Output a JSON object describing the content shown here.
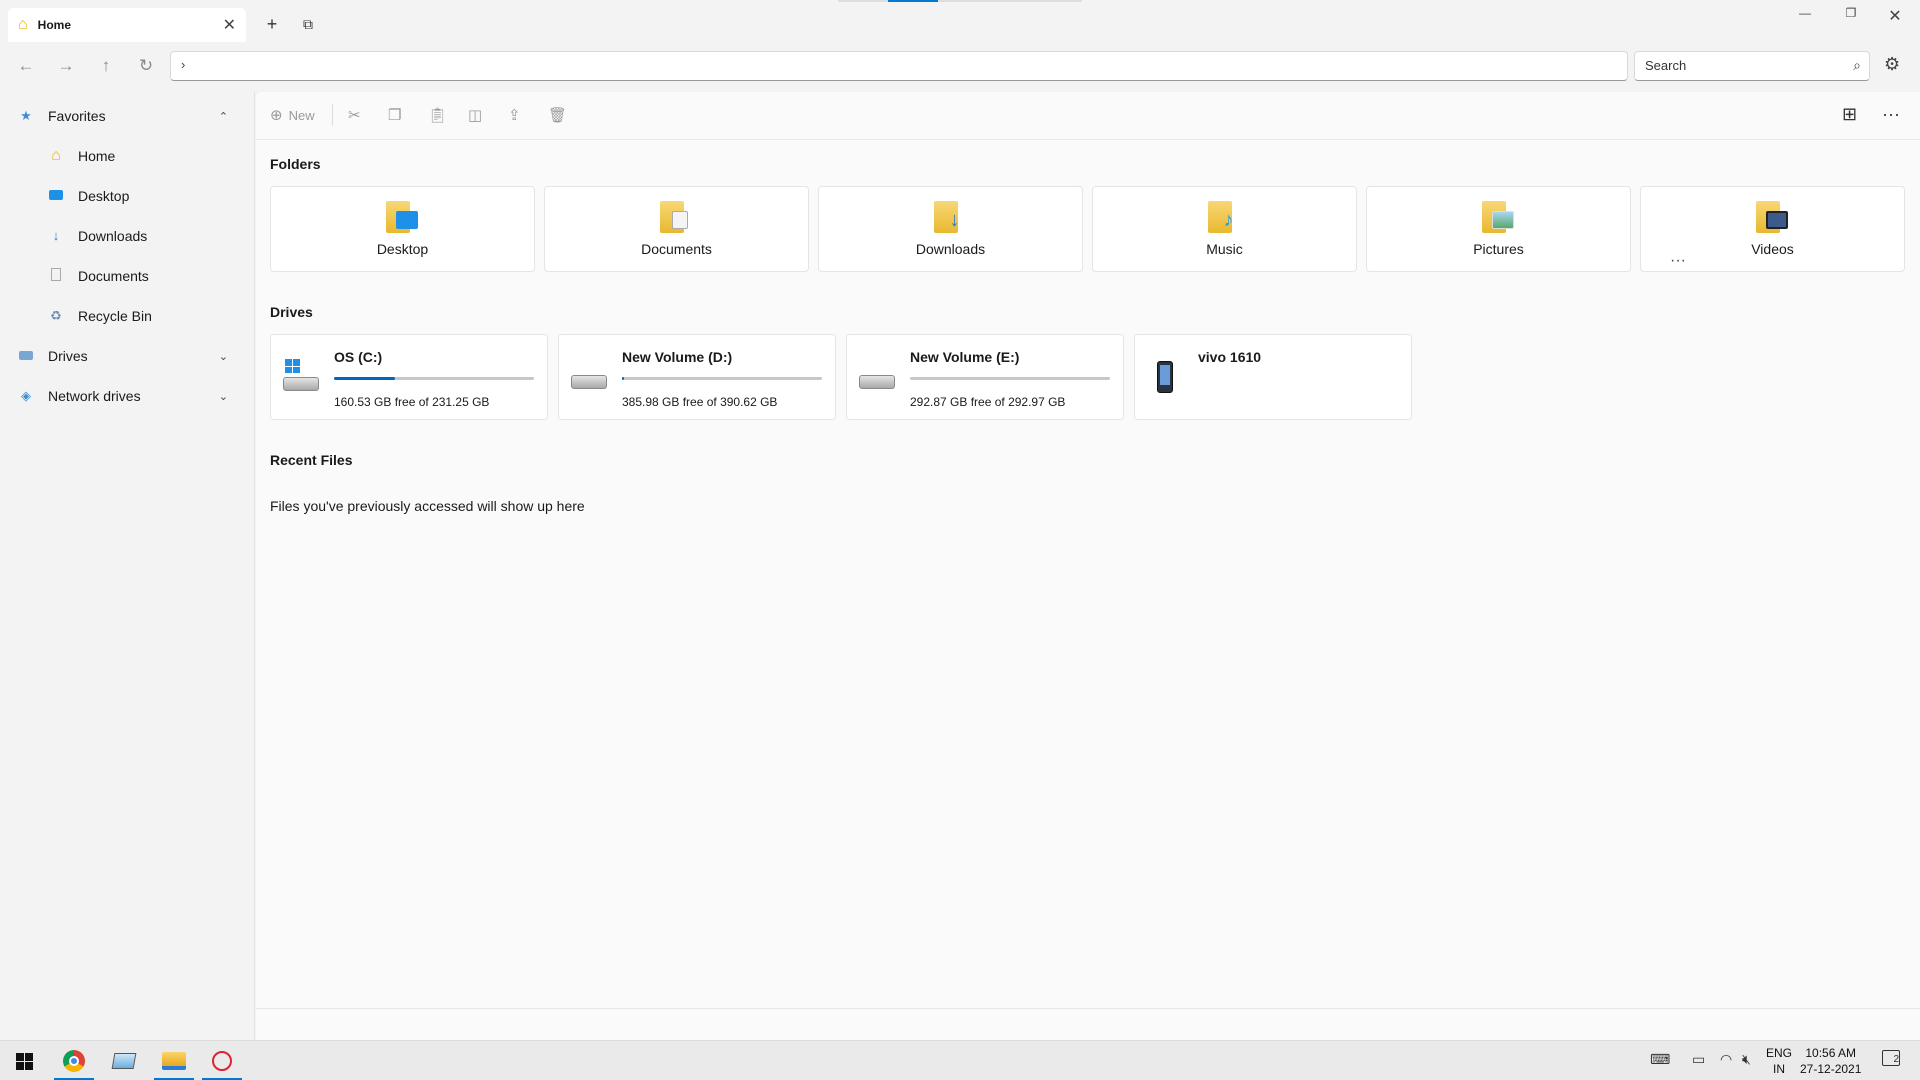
{
  "window": {
    "tab_title": "Home",
    "tab_close": "✕",
    "new_tab": "+",
    "tab_list": "⧉",
    "minimize": "—",
    "restore": "❐",
    "close": "✕"
  },
  "nav": {
    "back": "←",
    "forward": "→",
    "up": "↑",
    "refresh": "↻",
    "address_chevron": "›",
    "search_placeholder": "Search",
    "settings": "⚙"
  },
  "sidebar": {
    "items": [
      {
        "label": "Favorites",
        "icon": "favorites-star-icon",
        "chevron": "⌃"
      },
      {
        "label": "Home",
        "icon": "home-icon"
      },
      {
        "label": "Desktop",
        "icon": "desktop-icon"
      },
      {
        "label": "Downloads",
        "icon": "downloads-icon"
      },
      {
        "label": "Documents",
        "icon": "documents-icon"
      },
      {
        "label": "Recycle Bin",
        "icon": "recycle-bin-icon"
      },
      {
        "label": "Drives",
        "icon": "drives-icon",
        "chevron": "⌄"
      },
      {
        "label": "Network drives",
        "icon": "network-drives-icon",
        "chevron": "⌄"
      }
    ]
  },
  "commandbar": {
    "new_label": "New",
    "more": "···"
  },
  "sections": {
    "folders_title": "Folders",
    "drives_title": "Drives",
    "recent_title": "Recent Files",
    "recent_empty": "Files you've previously accessed will show up here",
    "drives_more": "···"
  },
  "folders": [
    {
      "label": "Desktop",
      "badge_color": "#1e90e8"
    },
    {
      "label": "Documents",
      "badge_color": "#f2f2f2"
    },
    {
      "label": "Downloads",
      "badge_color": "#2a7bd6"
    },
    {
      "label": "Music",
      "badge_color": "#2a9fe0"
    },
    {
      "label": "Pictures",
      "badge_color": "#6cb8e8"
    },
    {
      "label": "Videos",
      "badge_color": "#3d5a8a"
    }
  ],
  "drives": [
    {
      "name": "OS (C:)",
      "free": "160.53 GB free of 231.25 GB",
      "used_fraction": 0.306
    },
    {
      "name": "New Volume (D:)",
      "free": "385.98 GB free of 390.62 GB",
      "used_fraction": 0.012
    },
    {
      "name": "New Volume (E:)",
      "free": "292.87 GB free of 292.97 GB",
      "used_fraction": 0.0
    },
    {
      "name": "vivo 1610",
      "free": "",
      "used_fraction": null
    }
  ],
  "taskbar": {
    "lang_top": "ENG",
    "lang_bottom": "IN",
    "time": "10:56 AM",
    "date": "27-12-2021",
    "notif_count": "2"
  },
  "colors": {
    "accent": "#0078d4",
    "folder_yellow": "#f8d775",
    "drive_bar": "#0067c0"
  }
}
